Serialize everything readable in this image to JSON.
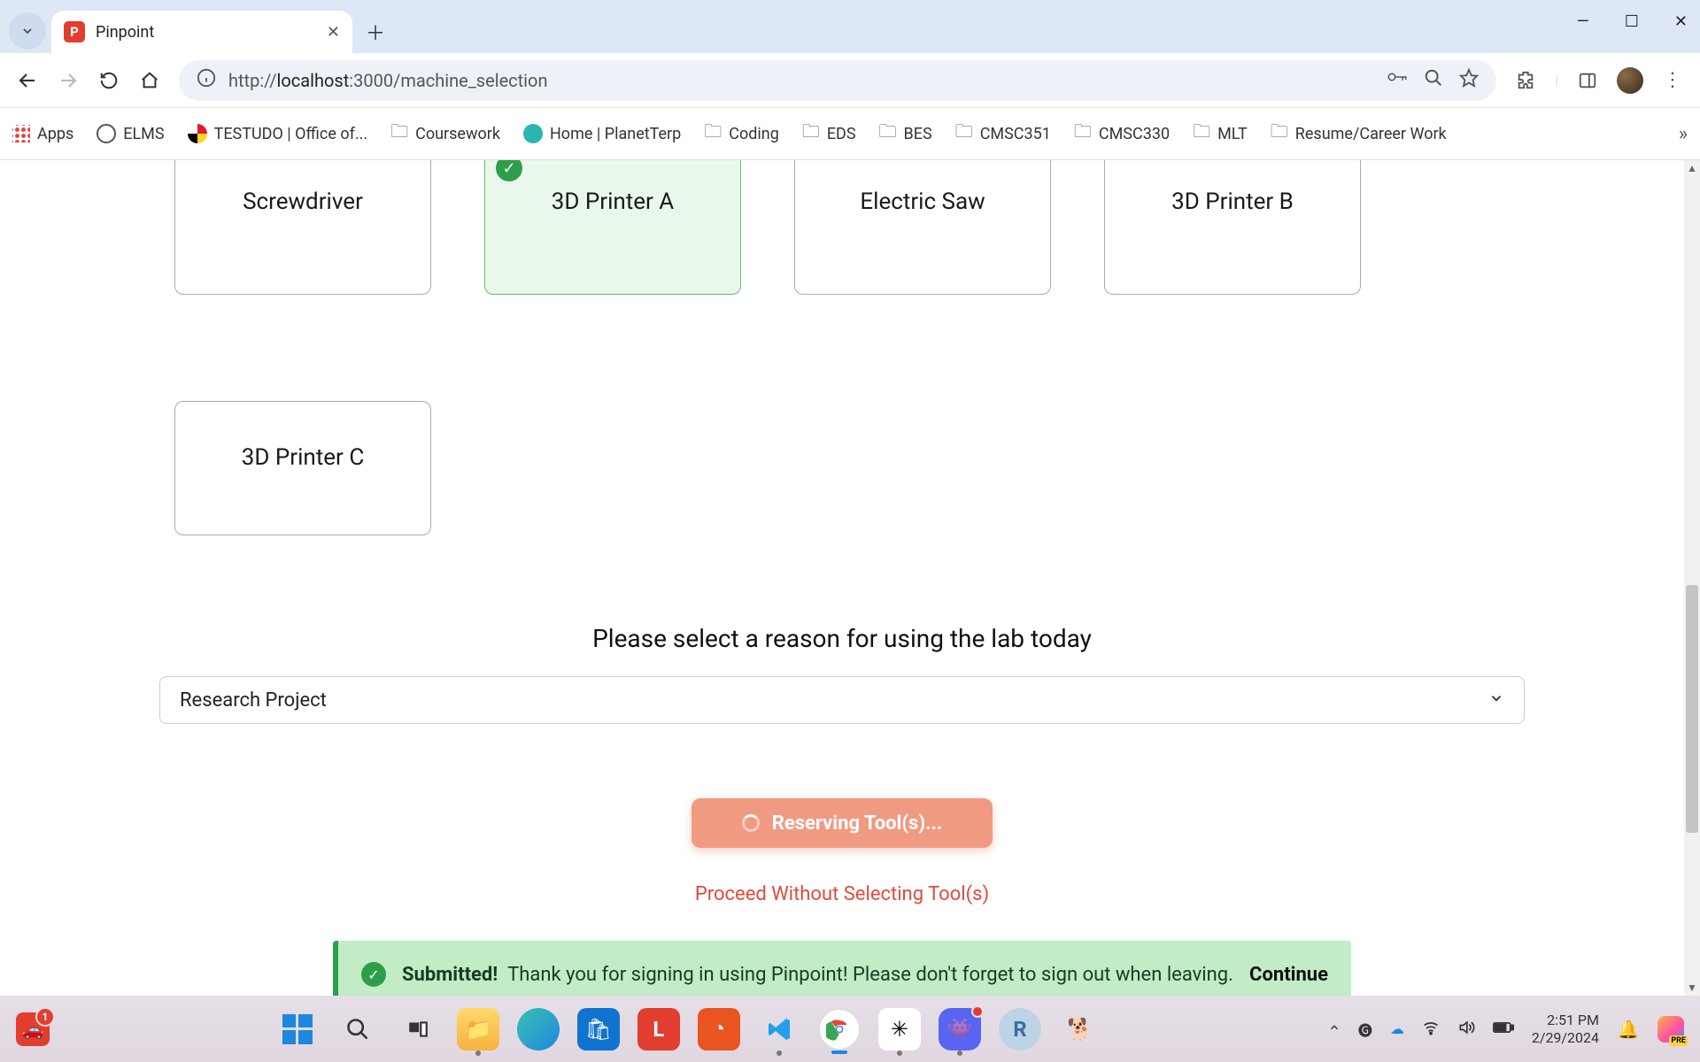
{
  "browser": {
    "tab_title": "Pinpoint",
    "url_prefix": "http://",
    "url_host": "localhost",
    "url_port_path": ":3000/machine_selection"
  },
  "bookmarks": [
    {
      "label": "Apps"
    },
    {
      "label": "ELMS"
    },
    {
      "label": "TESTUDO | Office of..."
    },
    {
      "label": "Coursework"
    },
    {
      "label": "Home | PlanetTerp"
    },
    {
      "label": "Coding"
    },
    {
      "label": "EDS"
    },
    {
      "label": "BES"
    },
    {
      "label": "CMSC351"
    },
    {
      "label": "CMSC330"
    },
    {
      "label": "MLT"
    },
    {
      "label": "Resume/Career Work"
    }
  ],
  "machines": {
    "row1": [
      {
        "label": "Screwdriver",
        "selected": false
      },
      {
        "label": "3D Printer A",
        "selected": true
      },
      {
        "label": "Electric Saw",
        "selected": false
      },
      {
        "label": "3D Printer B",
        "selected": false
      }
    ],
    "row2": [
      {
        "label": "3D Printer C",
        "selected": false
      }
    ]
  },
  "prompt": "Please select a reason for using the lab today",
  "reason_selected": "Research Project",
  "reserve_button": "Reserving Tool(s)...",
  "proceed_link": "Proceed Without Selecting Tool(s)",
  "alert": {
    "title": "Submitted!",
    "body": "Thank you for signing in using Pinpoint! Please don't forget to sign out when leaving.",
    "action": "Continue"
  },
  "system": {
    "time": "2:51 PM",
    "date": "2/29/2024",
    "car_badge": "1"
  }
}
